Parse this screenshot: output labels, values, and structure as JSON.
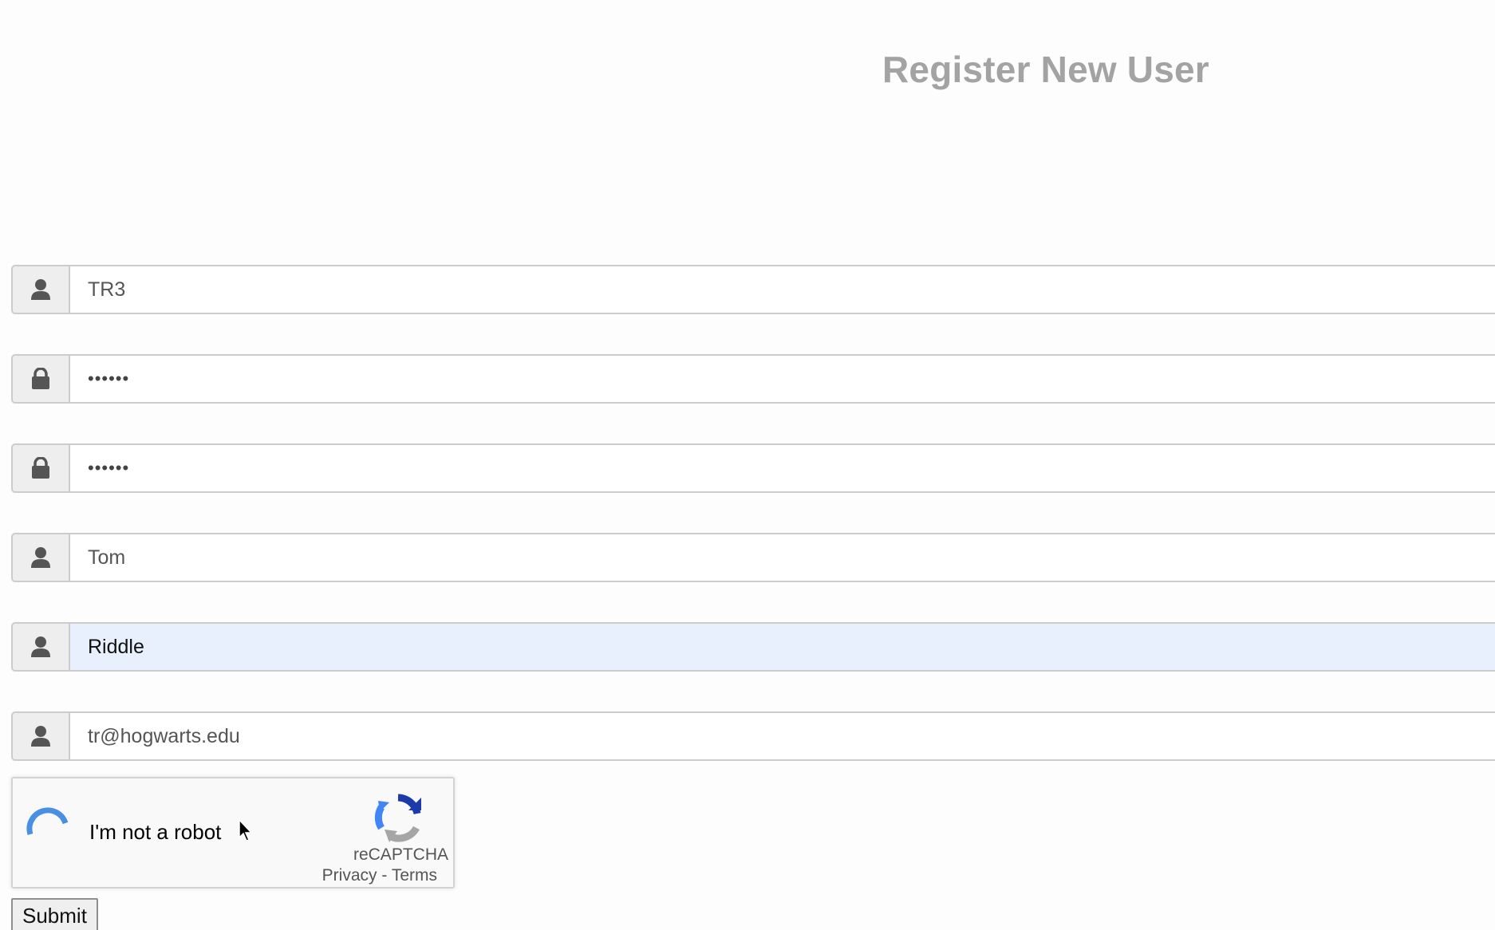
{
  "page": {
    "title": "Register New User"
  },
  "form": {
    "fields": [
      {
        "name": "username",
        "icon": "user-icon",
        "value": "TR3",
        "type": "text",
        "autofilled": false
      },
      {
        "name": "password",
        "icon": "lock-icon",
        "value": "••••••",
        "type": "password",
        "autofilled": false
      },
      {
        "name": "confirm-password",
        "icon": "lock-icon",
        "value": "••••••",
        "type": "password",
        "autofilled": false
      },
      {
        "name": "first-name",
        "icon": "user-icon",
        "value": "Tom",
        "type": "text",
        "autofilled": false
      },
      {
        "name": "last-name",
        "icon": "user-icon",
        "value": "Riddle",
        "type": "text",
        "autofilled": true
      },
      {
        "name": "email",
        "icon": "user-icon",
        "value": "tr@hogwarts.edu",
        "type": "text",
        "autofilled": false
      }
    ]
  },
  "captcha": {
    "label": "I'm not a robot",
    "brand": "reCAPTCHA",
    "privacy_link": "Privacy",
    "separator": " - ",
    "terms_link": "Terms"
  },
  "submit": {
    "label": "Submit"
  },
  "colors": {
    "title": "#a3a3a3",
    "addon_bg": "#eeeeee",
    "border": "#cccccc",
    "autofill_bg": "#e8f0fe",
    "spinner": "#4a90e2"
  }
}
